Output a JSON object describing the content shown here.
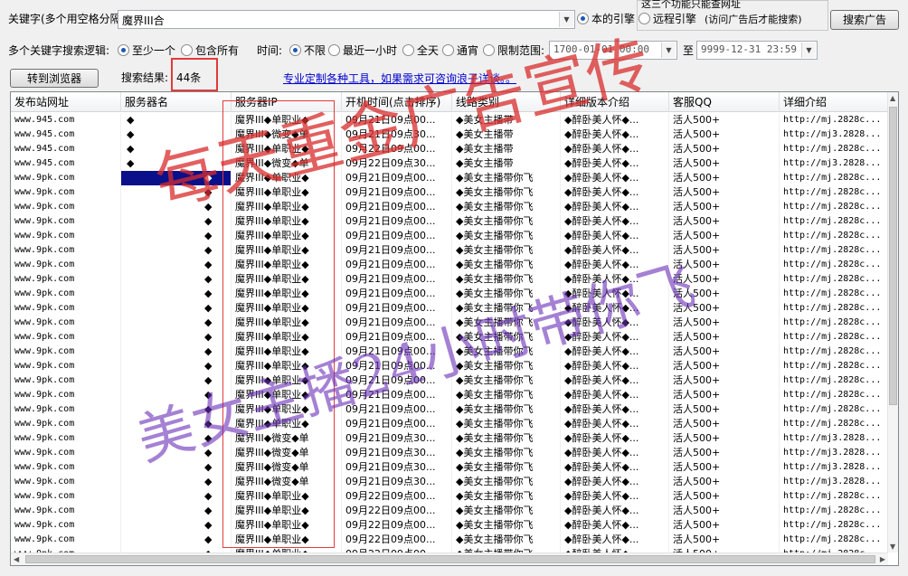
{
  "toolbar": {
    "keyword_label": "关键字(多个用空格分隔)",
    "keyword_value": "魔界III合",
    "engine_local": "本的引擎",
    "engine_remote": "远程引擎",
    "notice_title": "这三个功能只能查网址",
    "notice_text": "(访问广告后才能搜索)",
    "search_button": "搜索广告",
    "logic_label": "多个关键字搜索逻辑:",
    "logic_any": "至少一个",
    "logic_all": "包含所有",
    "time_label": "时间:",
    "time_unlimited": "不限",
    "time_hour": "最近一小时",
    "time_day": "全天",
    "time_overnight": "通宵",
    "time_range": "限制范围:",
    "date_from": "1700-01-01 00:00",
    "date_to_label": "至",
    "date_to": "9999-12-31 23:59",
    "browser_button": "转到浏览器",
    "result_label": "搜索结果:",
    "result_count": "44条",
    "promo_link": "专业定制各种工具，如果需求可咨询浪子详谈。。"
  },
  "columns": [
    "发布站网址",
    "服务器名",
    "服务器IP",
    "开机时间(点击排序)",
    "线路类别",
    "详细版本介绍",
    "客服QQ",
    "详细介绍"
  ],
  "rows": [
    [
      "www.945.com",
      "◆",
      "魔界III◆单职业◆",
      "09月21日09点00...",
      "◆美女主播带",
      "◆醉卧美人怀◆...",
      "活人500+",
      "http://mj.2828c..."
    ],
    [
      "www.945.com",
      "◆",
      "魔界III◆微变◆单",
      "09月21日09点30...",
      "◆美女主播带",
      "◆醉卧美人怀◆...",
      "活人500+",
      "http://mj3.2828..."
    ],
    [
      "www.945.com",
      "◆",
      "魔界III◆单职业◆",
      "09月22日09点00...",
      "◆美女主播带",
      "◆醉卧美人怀◆...",
      "活人500+",
      "http://mj.2828c..."
    ],
    [
      "www.945.com",
      "◆",
      "魔界III◆微变◆单",
      "09月22日09点30...",
      "◆美女主播带",
      "◆醉卧美人怀◆...",
      "活人500+",
      "http://mj3.2828..."
    ],
    [
      "www.9pk.com",
      "◆",
      "魔界III◆单职业◆",
      "09月21日09点00...",
      "◆美女主播带你飞",
      "◆醉卧美人怀◆...",
      "活人500+",
      "http://mj.2828c..."
    ],
    [
      "www.9pk.com",
      "◆",
      "魔界III◆单职业◆",
      "09月21日09点00...",
      "◆美女主播带你飞",
      "◆醉卧美人怀◆...",
      "活人500+",
      "http://mj.2828c..."
    ],
    [
      "www.9pk.com",
      "◆",
      "魔界III◆单职业◆",
      "09月21日09点00...",
      "◆美女主播带你飞",
      "◆醉卧美人怀◆...",
      "活人500+",
      "http://mj.2828c..."
    ],
    [
      "www.9pk.com",
      "◆",
      "魔界III◆单职业◆",
      "09月21日09点00...",
      "◆美女主播带你飞",
      "◆醉卧美人怀◆...",
      "活人500+",
      "http://mj.2828c..."
    ],
    [
      "www.9pk.com",
      "◆",
      "魔界III◆单职业◆",
      "09月21日09点00...",
      "◆美女主播带你飞",
      "◆醉卧美人怀◆...",
      "活人500+",
      "http://mj.2828c..."
    ],
    [
      "www.9pk.com",
      "◆",
      "魔界III◆单职业◆",
      "09月21日09点00...",
      "◆美女主播带你飞",
      "◆醉卧美人怀◆...",
      "活人500+",
      "http://mj.2828c..."
    ],
    [
      "www.9pk.com",
      "◆",
      "魔界III◆单职业◆",
      "09月21日09点00...",
      "◆美女主播带你飞",
      "◆醉卧美人怀◆...",
      "活人500+",
      "http://mj.2828c..."
    ],
    [
      "www.9pk.com",
      "◆",
      "魔界III◆单职业◆",
      "09月21日09点00...",
      "◆美女主播带你飞",
      "◆醉卧美人怀◆...",
      "活人500+",
      "http://mj.2828c..."
    ],
    [
      "www.9pk.com",
      "◆",
      "魔界III◆单职业◆",
      "09月21日09点00...",
      "◆美女主播带你飞",
      "◆醉卧美人怀◆...",
      "活人500+",
      "http://mj.2828c..."
    ],
    [
      "www.9pk.com",
      "◆",
      "魔界III◆单职业◆",
      "09月21日09点00...",
      "◆美女主播带你飞",
      "◆醉卧美人怀◆...",
      "活人500+",
      "http://mj.2828c..."
    ],
    [
      "www.9pk.com",
      "◆",
      "魔界III◆单职业◆",
      "09月21日09点00...",
      "◆美女主播带你飞",
      "◆醉卧美人怀◆...",
      "活人500+",
      "http://mj.2828c..."
    ],
    [
      "www.9pk.com",
      "◆",
      "魔界III◆单职业◆",
      "09月21日09点00...",
      "◆美女主播带你飞",
      "◆醉卧美人怀◆...",
      "活人500+",
      "http://mj.2828c..."
    ],
    [
      "www.9pk.com",
      "◆",
      "魔界III◆单职业◆",
      "09月21日09点00...",
      "◆美女主播带你飞",
      "◆醉卧美人怀◆...",
      "活人500+",
      "http://mj.2828c..."
    ],
    [
      "www.9pk.com",
      "◆",
      "魔界III◆单职业◆",
      "09月21日09点00...",
      "◆美女主播带你飞",
      "◆醉卧美人怀◆...",
      "活人500+",
      "http://mj.2828c..."
    ],
    [
      "www.9pk.com",
      "◆",
      "魔界III◆单职业◆",
      "09月21日09点00...",
      "◆美女主播带你飞",
      "◆醉卧美人怀◆...",
      "活人500+",
      "http://mj.2828c..."
    ],
    [
      "www.9pk.com",
      "◆",
      "魔界III◆单职业◆",
      "09月21日09点00...",
      "◆美女主播带你飞",
      "◆醉卧美人怀◆...",
      "活人500+",
      "http://mj.2828c..."
    ],
    [
      "www.9pk.com",
      "◆",
      "魔界III◆单职业◆",
      "09月21日09点00...",
      "◆美女主播带你飞",
      "◆醉卧美人怀◆...",
      "活人500+",
      "http://mj.2828c..."
    ],
    [
      "www.9pk.com",
      "◆",
      "魔界III◆单职业◆",
      "09月21日09点00...",
      "◆美女主播带你飞",
      "◆醉卧美人怀◆...",
      "活人500+",
      "http://mj.2828c..."
    ],
    [
      "www.9pk.com",
      "◆",
      "魔界III◆微变◆单",
      "09月21日09点30...",
      "◆美女主播带你飞",
      "◆醉卧美人怀◆...",
      "活人500+",
      "http://mj3.2828..."
    ],
    [
      "www.9pk.com",
      "◆",
      "魔界III◆微变◆单",
      "09月21日09点30...",
      "◆美女主播带你飞",
      "◆醉卧美人怀◆...",
      "活人500+",
      "http://mj3.2828..."
    ],
    [
      "www.9pk.com",
      "◆",
      "魔界III◆微变◆单",
      "09月21日09点30...",
      "◆美女主播带你飞",
      "◆醉卧美人怀◆...",
      "活人500+",
      "http://mj3.2828..."
    ],
    [
      "www.9pk.com",
      "◆",
      "魔界III◆微变◆单",
      "09月21日09点30...",
      "◆美女主播带你飞",
      "◆醉卧美人怀◆...",
      "活人500+",
      "http://mj3.2828..."
    ],
    [
      "www.9pk.com",
      "◆",
      "魔界III◆单职业◆",
      "09月22日09点00...",
      "◆美女主播带你飞",
      "◆醉卧美人怀◆...",
      "活人500+",
      "http://mj.2828c..."
    ],
    [
      "www.9pk.com",
      "◆",
      "魔界III◆单职业◆",
      "09月22日09点00...",
      "◆美女主播带你飞",
      "◆醉卧美人怀◆...",
      "活人500+",
      "http://mj.2828c..."
    ],
    [
      "www.9pk.com",
      "◆",
      "魔界III◆单职业◆",
      "09月22日09点00...",
      "◆美女主播带你飞",
      "◆醉卧美人怀◆...",
      "活人500+",
      "http://mj.2828c..."
    ],
    [
      "www.9pk.com",
      "◆",
      "魔界III◆单职业◆",
      "09月22日09点00...",
      "◆美女主播带你飞",
      "◆醉卧美人怀◆...",
      "活人500+",
      "http://mj.2828c..."
    ],
    [
      "www.9pk.com",
      "◆",
      "魔界III◆单职业◆",
      "09月22日09点00...",
      "◆美女主播带你飞",
      "◆醉卧美人怀◆...",
      "活人500+",
      "http://mj.2828c..."
    ],
    [
      "www.9pk.com",
      "◆",
      "魔界III◆单职业◆",
      "09月22日09点00...",
      "◆美女主播带你飞",
      "◆醉卧美人怀◆...",
      "活人500+",
      "http://mj.2828c..."
    ]
  ],
  "selected_row": 4,
  "watermarks": [
    "每天重金广告宣传",
    "美女主播24小时带你飞"
  ],
  "colors": {
    "selection": "#0a0f8a",
    "highlight_box": "#e23b3b",
    "link": "#0000cc",
    "watermark": "#d92c2c",
    "watermark_purple": "#6a2fb8"
  }
}
